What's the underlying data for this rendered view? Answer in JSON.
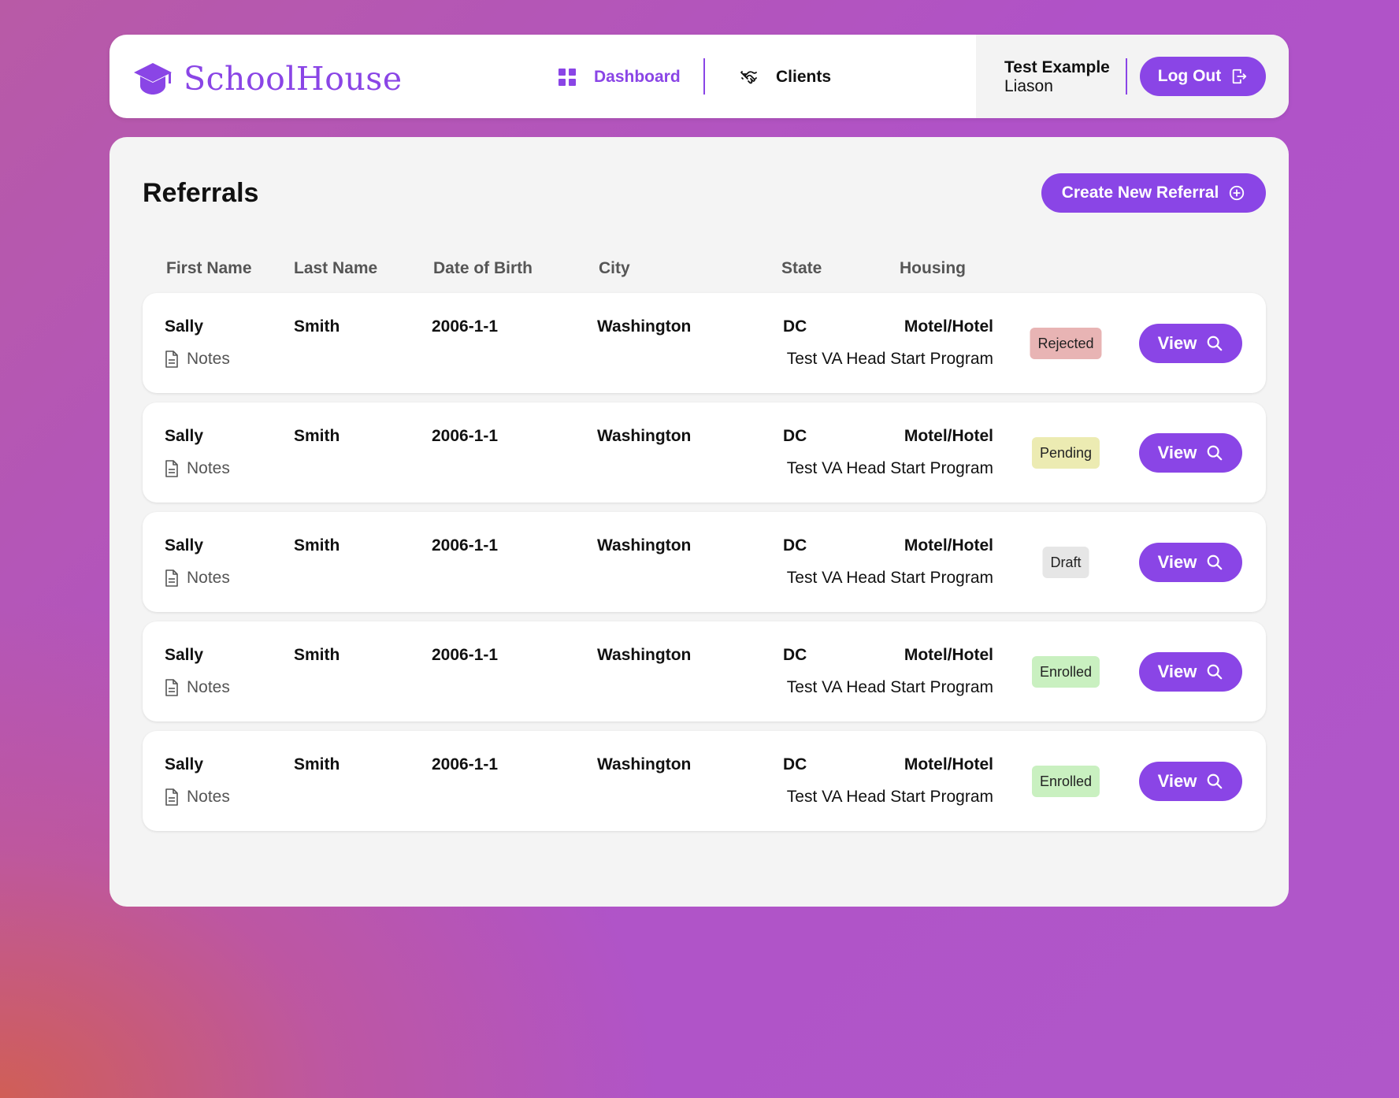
{
  "app": {
    "name": "SchoolHouse"
  },
  "nav": {
    "dashboard": "Dashboard",
    "clients": "Clients"
  },
  "user": {
    "name": "Test Example",
    "role": "Liason",
    "logout": "Log Out"
  },
  "page": {
    "title": "Referrals",
    "create_button": "Create New Referral"
  },
  "columns": [
    "First Name",
    "Last Name",
    "Date of Birth",
    "City",
    "State",
    "Housing"
  ],
  "notes_label": "Notes",
  "view_label": "View",
  "colors": {
    "accent": "#8a45e6",
    "rejected": "#e8b4b4",
    "pending": "#ecebb2",
    "draft": "#e6e6e6",
    "enrolled": "#c9f0c0"
  },
  "icons": [
    "graduation-cap-icon",
    "grid-icon",
    "handshake-icon",
    "logout-icon",
    "plus-circle-icon",
    "document-icon",
    "search-icon"
  ],
  "referrals": [
    {
      "first_name": "Sally",
      "last_name": "Smith",
      "dob": "2006-1-1",
      "city": "Washington",
      "state": "DC",
      "housing": "Motel/Hotel",
      "program": "Test VA Head Start Program",
      "status": "Rejected",
      "status_class": "rejected"
    },
    {
      "first_name": "Sally",
      "last_name": "Smith",
      "dob": "2006-1-1",
      "city": "Washington",
      "state": "DC",
      "housing": "Motel/Hotel",
      "program": "Test VA Head Start Program",
      "status": "Pending",
      "status_class": "pending"
    },
    {
      "first_name": "Sally",
      "last_name": "Smith",
      "dob": "2006-1-1",
      "city": "Washington",
      "state": "DC",
      "housing": "Motel/Hotel",
      "program": "Test VA Head Start Program",
      "status": "Draft",
      "status_class": "draft"
    },
    {
      "first_name": "Sally",
      "last_name": "Smith",
      "dob": "2006-1-1",
      "city": "Washington",
      "state": "DC",
      "housing": "Motel/Hotel",
      "program": "Test VA Head Start Program",
      "status": "Enrolled",
      "status_class": "enrolled"
    },
    {
      "first_name": "Sally",
      "last_name": "Smith",
      "dob": "2006-1-1",
      "city": "Washington",
      "state": "DC",
      "housing": "Motel/Hotel",
      "program": "Test VA Head Start Program",
      "status": "Enrolled",
      "status_class": "enrolled"
    }
  ]
}
